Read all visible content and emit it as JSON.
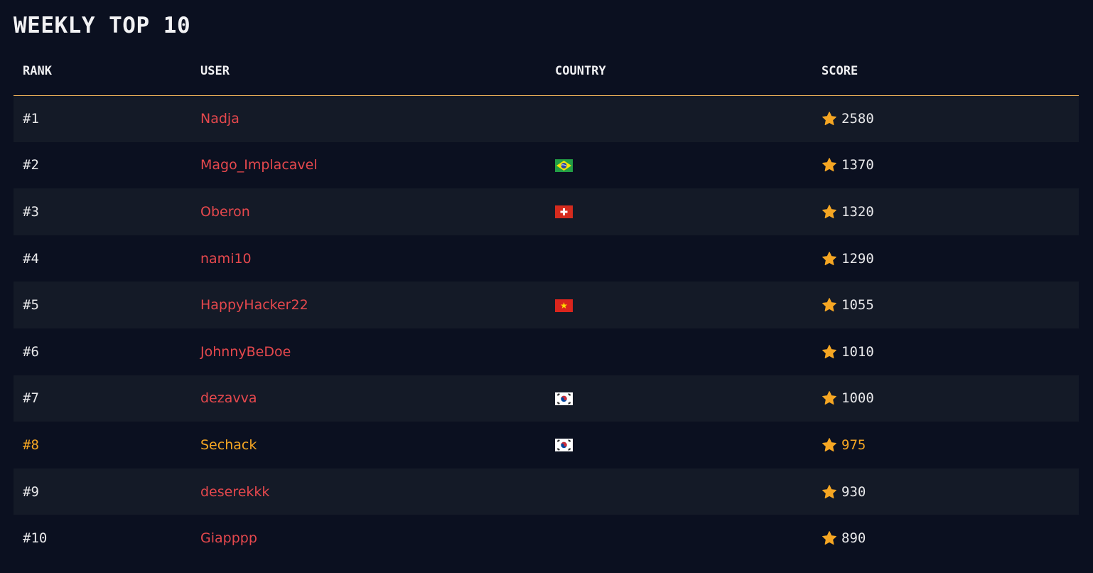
{
  "title": "WEEKLY TOP 10",
  "columns": {
    "rank": "RANK",
    "user": "USER",
    "country": "COUNTRY",
    "score": "SCORE"
  },
  "colors": {
    "background": "#0b1020",
    "row_alt": "#141a27",
    "user_link": "#e5484d",
    "highlight": "#f5a623",
    "star": "#f5a623",
    "header_rule": "#f2b55a"
  },
  "rows": [
    {
      "rank": "#1",
      "user": "Nadja",
      "country": "",
      "score": "2580",
      "highlight": false
    },
    {
      "rank": "#2",
      "user": "Mago_Implacavel",
      "country": "br",
      "score": "1370",
      "highlight": false
    },
    {
      "rank": "#3",
      "user": "Oberon",
      "country": "ch",
      "score": "1320",
      "highlight": false
    },
    {
      "rank": "#4",
      "user": "nami10",
      "country": "",
      "score": "1290",
      "highlight": false
    },
    {
      "rank": "#5",
      "user": "HappyHacker22",
      "country": "vn",
      "score": "1055",
      "highlight": false
    },
    {
      "rank": "#6",
      "user": "JohnnyBeDoe",
      "country": "",
      "score": "1010",
      "highlight": false
    },
    {
      "rank": "#7",
      "user": "dezavva",
      "country": "kr",
      "score": "1000",
      "highlight": false
    },
    {
      "rank": "#8",
      "user": "Sechack",
      "country": "kr",
      "score": "975",
      "highlight": true
    },
    {
      "rank": "#9",
      "user": "deserekkk",
      "country": "",
      "score": "930",
      "highlight": false
    },
    {
      "rank": "#10",
      "user": "Giapppp",
      "country": "",
      "score": "890",
      "highlight": false
    }
  ]
}
